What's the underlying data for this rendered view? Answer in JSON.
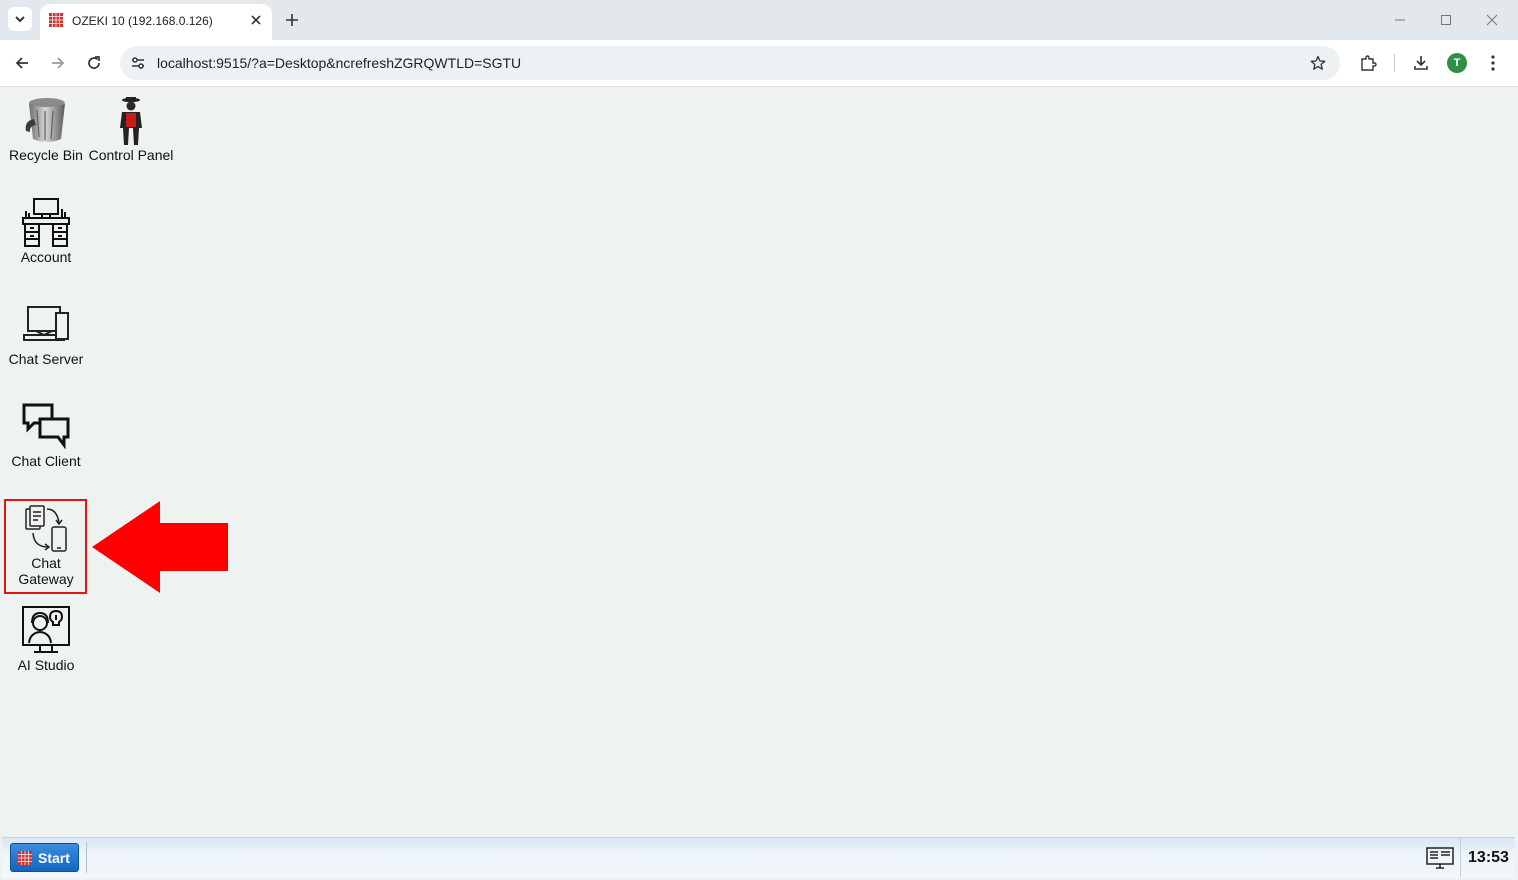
{
  "browser": {
    "tab": {
      "title": "OZEKI 10 (192.168.0.126)",
      "favicon": "ozeki-grid-icon"
    },
    "address": {
      "url": "localhost:9515/?a=Desktop&ncrefreshZGRQWTLD=SGTU"
    },
    "profile": {
      "initial": "T",
      "color": "#2f8f46"
    }
  },
  "desktop": {
    "icons": [
      {
        "label": "Recycle Bin",
        "icon": "recycle-bin-icon"
      },
      {
        "label": "Control Panel",
        "icon": "control-panel-icon"
      },
      {
        "label": "Account",
        "icon": "account-icon"
      },
      {
        "label": "Chat Server",
        "icon": "chat-server-icon"
      },
      {
        "label": "Chat Client",
        "icon": "chat-client-icon"
      },
      {
        "label": "Chat Gateway",
        "icon": "chat-gateway-icon"
      },
      {
        "label": "AI Studio",
        "icon": "ai-studio-icon"
      }
    ],
    "highlight": {
      "target": "Chat Gateway",
      "color": "#e11414"
    }
  },
  "taskbar": {
    "start_label": "Start",
    "clock": "13:53"
  }
}
